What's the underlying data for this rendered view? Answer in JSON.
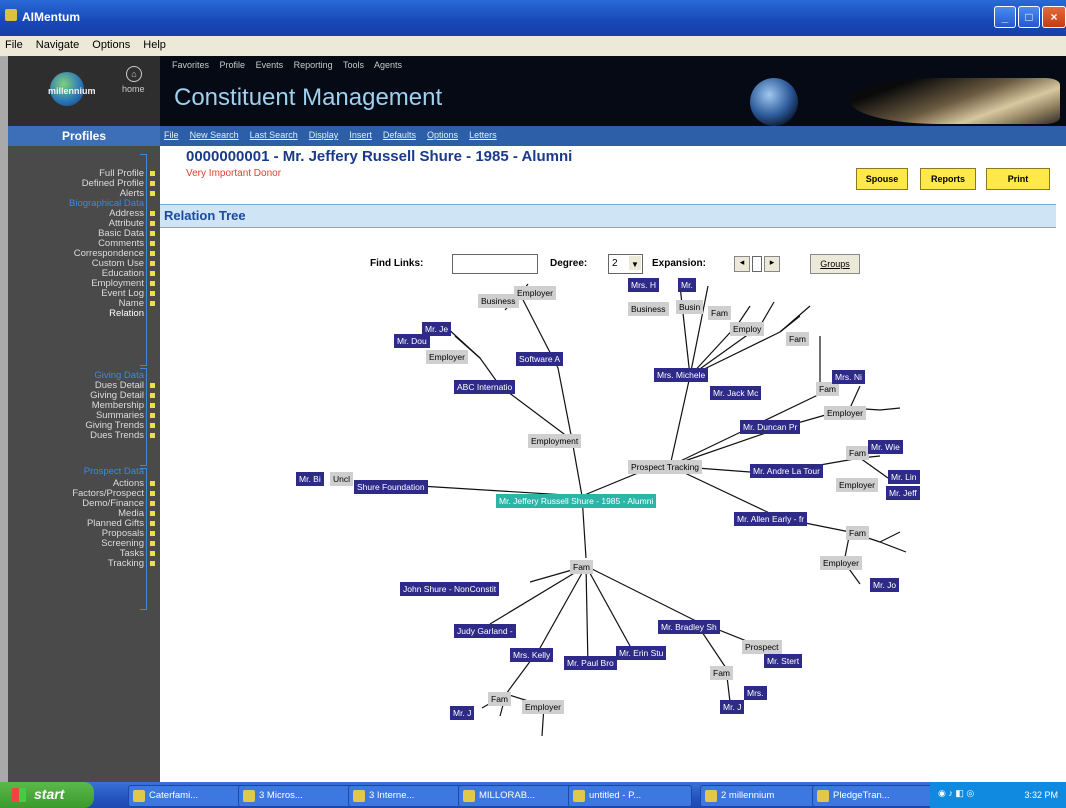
{
  "window": {
    "title": "AIMentum"
  },
  "menubar": [
    "File",
    "Navigate",
    "Options",
    "Help"
  ],
  "brand": {
    "name": "millennium",
    "home_label": "home"
  },
  "banner": {
    "top_links": [
      "Favorites",
      "Profile",
      "Events",
      "Reporting",
      "Tools",
      "Agents"
    ],
    "heading": "Constituent Management"
  },
  "profiles_header": "Profiles",
  "subnav": [
    "File",
    "New Search",
    "Last Search",
    "Display",
    "Insert",
    "Defaults",
    "Options",
    "Letters"
  ],
  "sidebar": {
    "groups": [
      {
        "header": "",
        "items": [
          "Full Profile",
          "Defined Profile",
          "Alerts"
        ]
      },
      {
        "header": "Biographical Data",
        "items": [
          "Address",
          "Attribute",
          "Basic Data",
          "Comments",
          "Correspondence",
          "Custom Use",
          "Education",
          "Employment",
          "Event Log",
          "Name",
          "Relation"
        ]
      },
      {
        "header": "Giving Data",
        "items": [
          "Dues Detail",
          "Giving Detail",
          "Membership",
          "Summaries",
          "Giving Trends",
          "Dues Trends"
        ]
      },
      {
        "header": "Prospect Data",
        "items": [
          "Actions",
          "Factors/Prospect",
          "Demo/Finance",
          "Media",
          "Planned Gifts",
          "Proposals",
          "Screening",
          "Tasks",
          "Tracking"
        ]
      }
    ],
    "selected": "Relation"
  },
  "record": {
    "title": "0000000001 - Mr. Jeffery Russell Shure - 1985 - Alumni",
    "subtitle": "Very Important Donor",
    "buttons": [
      "Spouse",
      "Reports",
      "Print"
    ]
  },
  "section_title": "Relation Tree",
  "controls": {
    "find_label": "Find Links:",
    "find_value": "",
    "degree_label": "Degree:",
    "degree_value": "2",
    "expansion_label": "Expansion:",
    "groups_button": "Groups"
  },
  "tree_nodes": [
    {
      "text": "Mr. Jeffery Russell Shure - 1985 - Alumni",
      "kind": "t"
    },
    {
      "text": "Employment",
      "kind": "g"
    },
    {
      "text": "Prospect Tracking",
      "kind": "g"
    },
    {
      "text": "Fam",
      "kind": "g"
    },
    {
      "text": "Shure Foundation",
      "kind": "p"
    },
    {
      "text": "ABC Internatio",
      "kind": "p"
    },
    {
      "text": "Software A",
      "kind": "p"
    },
    {
      "text": "Employer",
      "kind": "g"
    },
    {
      "text": "Business",
      "kind": "g"
    },
    {
      "text": "Employer",
      "kind": "g"
    },
    {
      "text": "Mr. Je",
      "kind": "p"
    },
    {
      "text": "Mr. Dou",
      "kind": "p"
    },
    {
      "text": "Mrs. Michele",
      "kind": "p"
    },
    {
      "text": "Mr. Jack Mc",
      "kind": "p"
    },
    {
      "text": "Mr. Duncan Pr",
      "kind": "p"
    },
    {
      "text": "Mr. Andre La Tour",
      "kind": "p"
    },
    {
      "text": "Mr. Allen Early - fr",
      "kind": "p"
    },
    {
      "text": "Business",
      "kind": "g"
    },
    {
      "text": "Mrs. H",
      "kind": "p"
    },
    {
      "text": "Mr.",
      "kind": "p"
    },
    {
      "text": "Busin",
      "kind": "g"
    },
    {
      "text": "Fam",
      "kind": "g"
    },
    {
      "text": "Employ",
      "kind": "g"
    },
    {
      "text": "Fam",
      "kind": "g"
    },
    {
      "text": "Fam",
      "kind": "g"
    },
    {
      "text": "Mrs. Ni",
      "kind": "p"
    },
    {
      "text": "Employer",
      "kind": "g"
    },
    {
      "text": "Fam",
      "kind": "g"
    },
    {
      "text": "Mr. Wie",
      "kind": "p"
    },
    {
      "text": "Employer",
      "kind": "g"
    },
    {
      "text": "Mr. Lin",
      "kind": "p"
    },
    {
      "text": "Mr. Jeff",
      "kind": "p"
    },
    {
      "text": "Fam",
      "kind": "g"
    },
    {
      "text": "Employer",
      "kind": "g"
    },
    {
      "text": "Mr. Jo",
      "kind": "p"
    },
    {
      "text": "Mr. Bi",
      "kind": "p"
    },
    {
      "text": "Uncl",
      "kind": "g"
    },
    {
      "text": "John Shure - NonConstit",
      "kind": "p"
    },
    {
      "text": "Judy Garland -",
      "kind": "p"
    },
    {
      "text": "Mrs. Kelly",
      "kind": "p"
    },
    {
      "text": "Mr. Paul Bro",
      "kind": "p"
    },
    {
      "text": "Mr. Erin Stu",
      "kind": "p"
    },
    {
      "text": "Mr. Bradley Sh",
      "kind": "p"
    },
    {
      "text": "Prospect",
      "kind": "g"
    },
    {
      "text": "Mr. Stert",
      "kind": "p"
    },
    {
      "text": "Fam",
      "kind": "g"
    },
    {
      "text": "Mrs.",
      "kind": "p"
    },
    {
      "text": "Mr. J",
      "kind": "p"
    },
    {
      "text": "Fam",
      "kind": "g"
    },
    {
      "text": "Employer",
      "kind": "g"
    },
    {
      "text": "Mr. J",
      "kind": "p"
    }
  ],
  "taskbar": {
    "start": "start",
    "tasks": [
      "Caterfami...",
      "3 Micros...",
      "3 Interne...",
      "MILLORAB...",
      "untitled - P...",
      "2 millennium",
      "PledgeTran..."
    ],
    "clock": "3:32 PM"
  }
}
